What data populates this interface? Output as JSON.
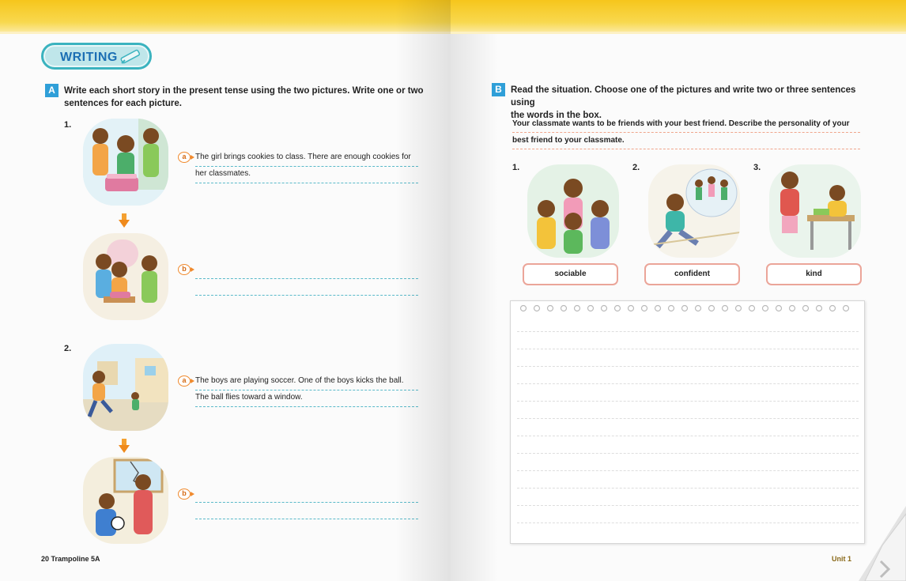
{
  "left_page": {
    "badge": "WRITING",
    "section_a": {
      "letter": "A",
      "instruction_line1": "Write each short story in the present tense using the two pictures. Write one or two",
      "instruction_line2": "sentences for each picture."
    },
    "items": [
      {
        "number": "1.",
        "a_marker": "a",
        "a_line1": "The girl brings cookies to class. There are enough cookies for",
        "a_line2": "her classmates.",
        "b_marker": "b"
      },
      {
        "number": "2.",
        "a_marker": "a",
        "a_line1": "The boys are playing soccer. One of the boys kicks the ball.",
        "a_line2": "The ball flies toward a window.",
        "b_marker": "b"
      }
    ],
    "footer": "20 Trampoline 5A"
  },
  "right_page": {
    "section_b": {
      "letter": "B",
      "instruction_line1": "Read the situation. Choose one of the pictures and write two or three sentences using",
      "instruction_line2": "the words in the box."
    },
    "situation_line1": "Your classmate wants to be friends with your best friend. Describe the personality of your",
    "situation_line2": "best friend to your classmate.",
    "pictures": [
      {
        "number": "1.",
        "word": "sociable"
      },
      {
        "number": "2.",
        "word": "confident"
      },
      {
        "number": "3.",
        "word": "kind"
      }
    ],
    "footer": "Unit 1"
  },
  "colors": {
    "top_band": "#f6c61c",
    "badge_border": "#3bb3bf",
    "badge_text": "#1c6fb4",
    "section_letter": "#2f9fd8",
    "marker": "#f08a2e",
    "dashed_line_left": "#59b9c9",
    "dashed_line_right": "#f0a58c",
    "word_box_border": "#eba599"
  }
}
